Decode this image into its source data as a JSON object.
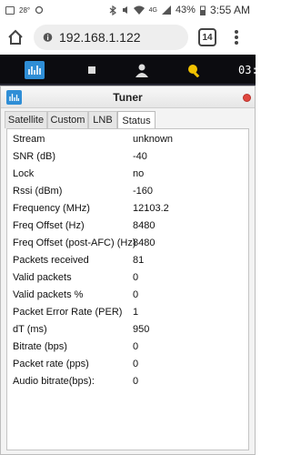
{
  "status_bar": {
    "temperature": "28°",
    "network": "4G",
    "battery": "43%",
    "time": "3:55 AM"
  },
  "browser": {
    "url": "192.168.1.122",
    "tab_count": "14"
  },
  "app_nav": {
    "clock": "03:"
  },
  "dialog": {
    "title": "Tuner",
    "tabs": [
      {
        "label": "Satellite",
        "active": false
      },
      {
        "label": "Custom",
        "active": false
      },
      {
        "label": "LNB",
        "active": false
      },
      {
        "label": "Status",
        "active": true
      }
    ],
    "status_rows": [
      {
        "label": "Stream",
        "value": "unknown"
      },
      {
        "label": "SNR (dB)",
        "value": "-40"
      },
      {
        "label": "Lock",
        "value": "no"
      },
      {
        "label": "Rssi (dBm)",
        "value": "-160"
      },
      {
        "label": "Frequency (MHz)",
        "value": "12103.2"
      },
      {
        "label": "Freq Offset (Hz)",
        "value": "8480"
      },
      {
        "label": "Freq Offset (post-AFC) (Hz)",
        "value": "8480"
      },
      {
        "label": "Packets received",
        "value": "81"
      },
      {
        "label": "Valid packets",
        "value": "0"
      },
      {
        "label": "Valid packets %",
        "value": "0"
      },
      {
        "label": "Packet Error Rate (PER)",
        "value": "1"
      },
      {
        "label": "dT (ms)",
        "value": "950"
      },
      {
        "label": "Bitrate (bps)",
        "value": "0"
      },
      {
        "label": "Packet rate (pps)",
        "value": "0"
      },
      {
        "label": "Audio bitrate(bps):",
        "value": "0"
      }
    ]
  },
  "colors": {
    "nav_bg": "#0c0c10",
    "accent": "#2f8ed6",
    "close": "#e0473f"
  }
}
